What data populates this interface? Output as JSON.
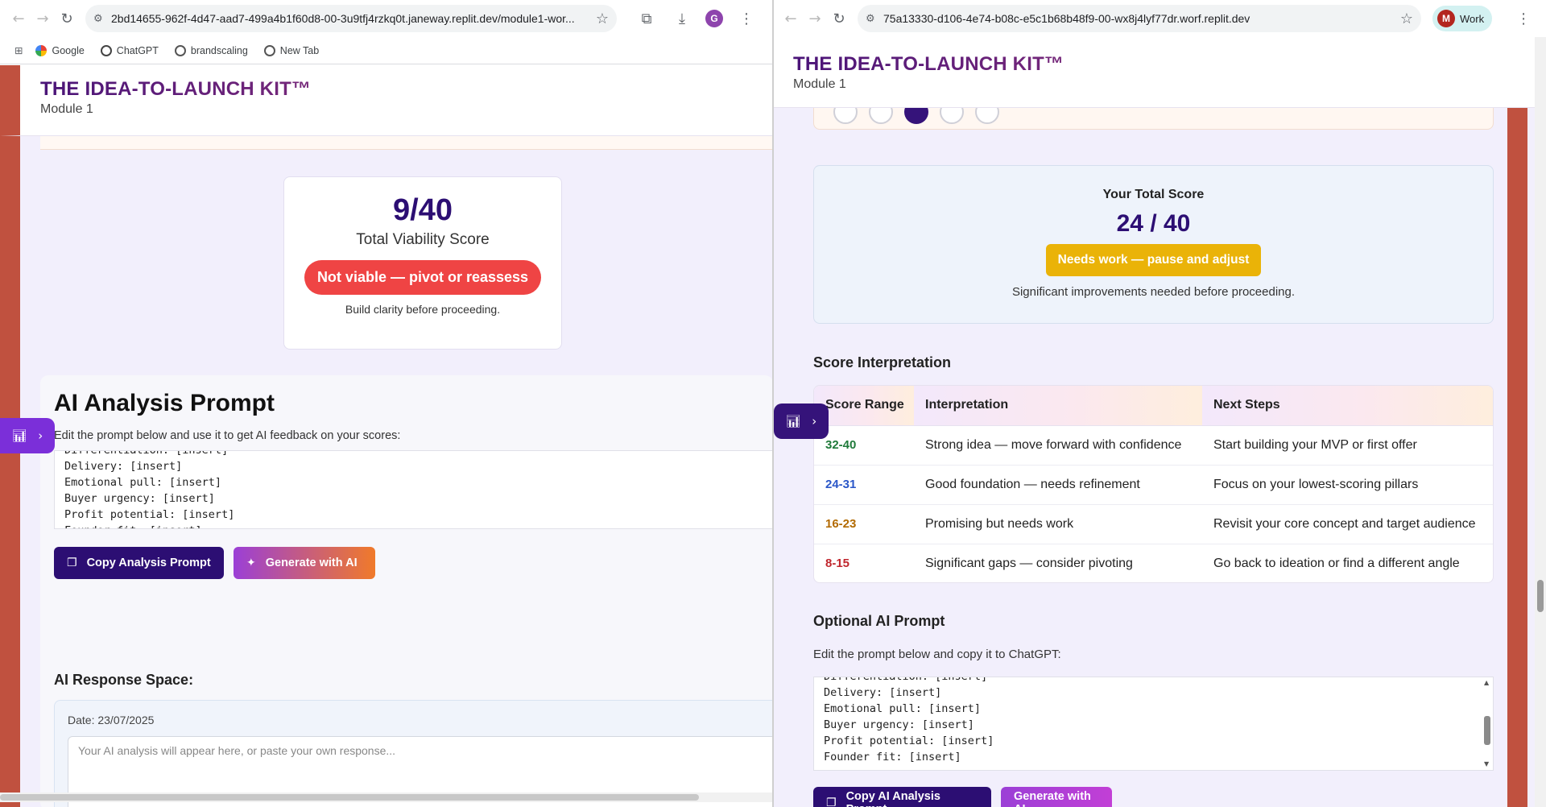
{
  "left": {
    "url": "2bd14655-962f-4d47-aad7-499a4b1f60d8-00-3u9tfj4rzkq0t.janeway.replit.dev/module1-wor...",
    "avatar_letter": "G",
    "bookmarks": [
      "Google",
      "ChatGPT",
      "brandscaling",
      "New Tab"
    ],
    "brand": "THE IDEA-TO-LAUNCH KIT™",
    "module": "Module 1",
    "score": {
      "value": "9/40",
      "label": "Total Viability Score",
      "badge": "Not viable — pivot or reassess",
      "note": "Build clarity before proceeding."
    },
    "analysis": {
      "title": "AI Analysis Prompt",
      "subtitle": "Edit the prompt below and use it to get AI feedback on your scores:",
      "prompt_lines": [
        "Differentiation: [insert]",
        "Delivery: [insert]",
        "Emotional pull: [insert]",
        "Buyer urgency: [insert]",
        "Profit potential: [insert]",
        "Founder fit: [insert]"
      ],
      "copy_button": "Copy Analysis Prompt",
      "generate_button": "Generate with AI",
      "response_title": "AI Response Space:",
      "date": "Date: 23/07/2025",
      "response_placeholder": "Your AI analysis will appear here, or paste your own response..."
    }
  },
  "right": {
    "url": "75a13330-d106-4e74-b08c-e5c1b68b48f9-00-wx8j4lyf77dr.worf.replit.dev",
    "profile_letter": "M",
    "profile_label": "Work",
    "brand": "THE IDEA-TO-LAUNCH KIT™",
    "module": "Module 1",
    "total": {
      "label": "Your Total Score",
      "value": "24 / 40",
      "badge": "Needs work — pause and adjust",
      "note": "Significant improvements needed before proceeding."
    },
    "interpretation": {
      "title": "Score Interpretation",
      "headers": [
        "Score Range",
        "Interpretation",
        "Next Steps"
      ],
      "rows": [
        {
          "range": "32-40",
          "interp": "Strong idea — move forward with confidence",
          "next": "Start building your MVP or first offer",
          "color": "#1f7a3a"
        },
        {
          "range": "24-31",
          "interp": "Good foundation — needs refinement",
          "next": "Focus on your lowest-scoring pillars",
          "color": "#2b57c8"
        },
        {
          "range": "16-23",
          "interp": "Promising but needs work",
          "next": "Revisit your core concept and target audience",
          "color": "#b26a00"
        },
        {
          "range": "8-15",
          "interp": "Significant gaps — consider pivoting",
          "next": "Go back to ideation or find a different angle",
          "color": "#c0262d"
        }
      ]
    },
    "optional": {
      "title": "Optional AI Prompt",
      "subtitle": "Edit the prompt below and copy it to ChatGPT:",
      "prompt_lines": [
        "Differentiation: [insert]",
        "Delivery: [insert]",
        "Emotional pull: [insert]",
        "Buyer urgency: [insert]",
        "Profit potential: [insert]",
        "Founder fit: [insert]"
      ],
      "copy_button": "Copy AI Analysis Prompt",
      "generate_button": "Generate with AI"
    }
  },
  "colors": {
    "brand_dark": "#2c0e73",
    "danger": "#ef4444",
    "warning": "#eab308",
    "gradient_start": "#9b3fd6",
    "gradient_end": "#f07a2a"
  }
}
